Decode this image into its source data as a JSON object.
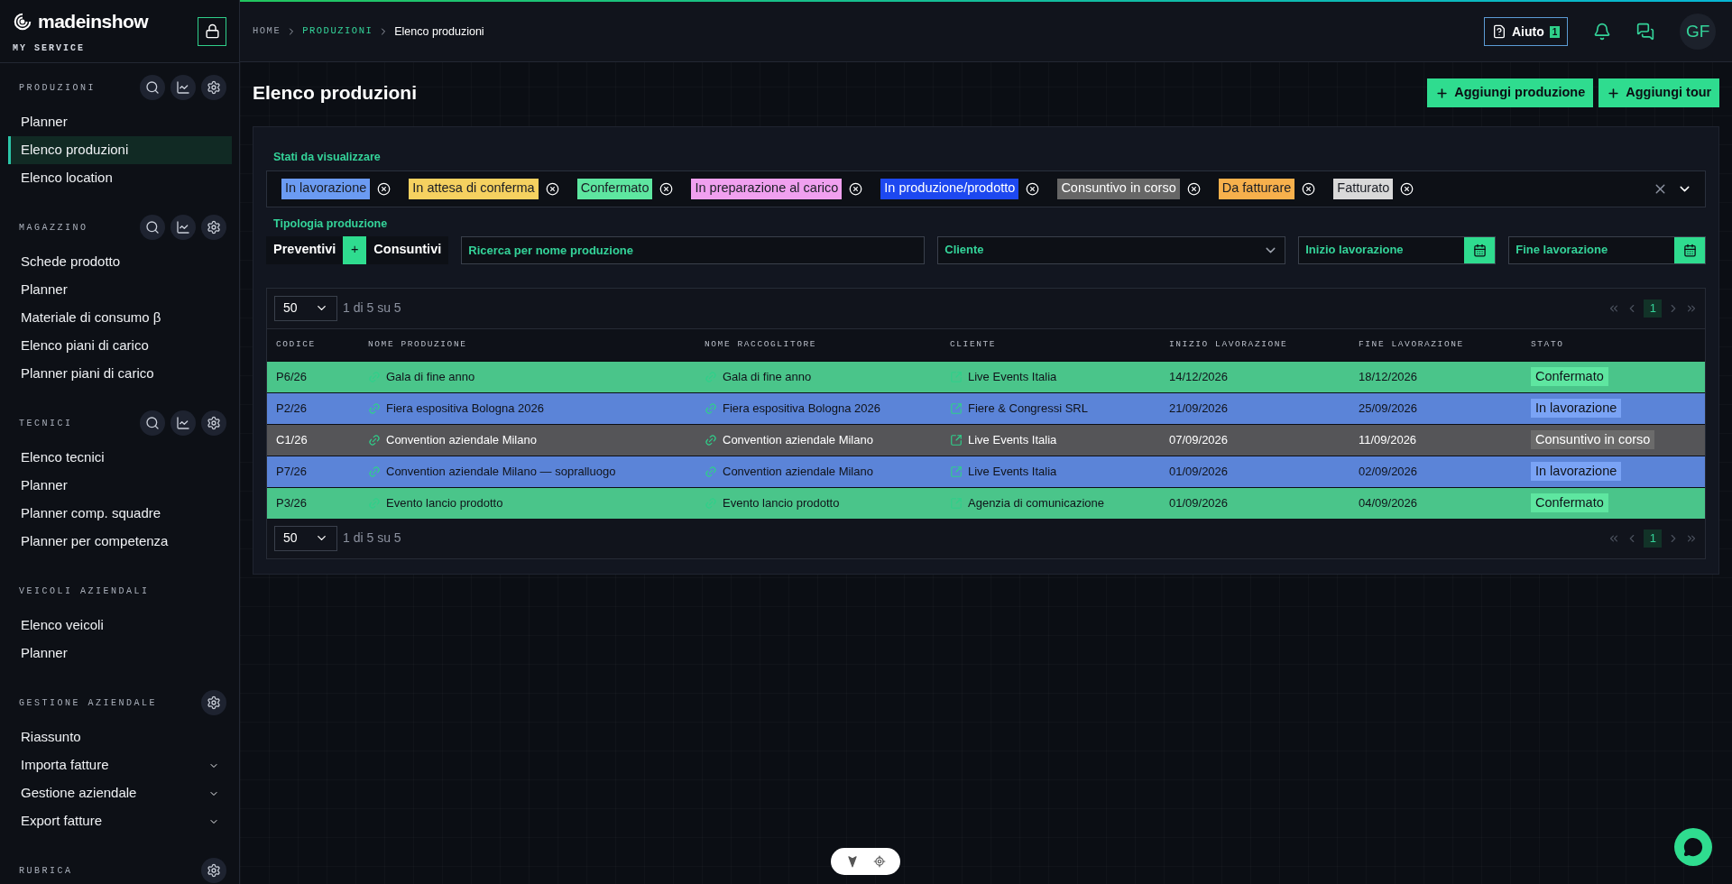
{
  "sidebar": {
    "logo": "madeinshow",
    "subtitle": "MY SERVICE",
    "sections": [
      {
        "title": "PRODUZIONI",
        "tools": [
          {
            "kind": "search"
          },
          {
            "kind": "chart"
          },
          {
            "kind": "settings"
          }
        ],
        "items": [
          {
            "label": "Planner",
            "selected": false,
            "kind": "link"
          },
          {
            "label": "Elenco produzioni",
            "selected": true,
            "kind": "link"
          },
          {
            "label": "Elenco location",
            "selected": false,
            "kind": "link"
          }
        ]
      },
      {
        "title": "MAGAZZINO",
        "tools": [
          {
            "kind": "search"
          },
          {
            "kind": "chart"
          },
          {
            "kind": "settings"
          }
        ],
        "items": [
          {
            "label": "Schede prodotto",
            "selected": false,
            "kind": "link"
          },
          {
            "label": "Planner",
            "selected": false,
            "kind": "link"
          },
          {
            "label": "Materiale di consumo β",
            "selected": false,
            "kind": "link"
          },
          {
            "label": "Elenco piani di carico",
            "selected": false,
            "kind": "link"
          },
          {
            "label": "Planner piani di carico",
            "selected": false,
            "kind": "link"
          }
        ]
      },
      {
        "title": "TECNICI",
        "tools": [
          {
            "kind": "search"
          },
          {
            "kind": "chart"
          },
          {
            "kind": "settings"
          }
        ],
        "items": [
          {
            "label": "Elenco tecnici",
            "selected": false,
            "kind": "link"
          },
          {
            "label": "Planner",
            "selected": false,
            "kind": "link"
          },
          {
            "label": "Planner comp. squadre",
            "selected": false,
            "kind": "link"
          },
          {
            "label": "Planner per competenza",
            "selected": false,
            "kind": "link"
          }
        ]
      },
      {
        "title": "VEICOLI AZIENDALI",
        "items": [
          {
            "label": "Elenco veicoli",
            "selected": false,
            "kind": "link"
          },
          {
            "label": "Planner",
            "selected": false,
            "kind": "link"
          }
        ]
      },
      {
        "title": "GESTIONE AZIENDALE",
        "tools": [
          {
            "kind": "settings"
          }
        ],
        "items": [
          {
            "label": "Riassunto",
            "selected": false,
            "kind": "link"
          },
          {
            "label": "Importa fatture",
            "selected": false,
            "kind": "group"
          },
          {
            "label": "Gestione aziendale",
            "selected": false,
            "kind": "group"
          },
          {
            "label": "Export fatture",
            "selected": false,
            "kind": "group"
          }
        ]
      },
      {
        "title": "RUBRICA",
        "tools": [
          {
            "kind": "settings"
          }
        ]
      }
    ]
  },
  "breadcrumb": [
    {
      "label": "HOME",
      "kind": "link"
    },
    {
      "label": "PRODUZIONI",
      "kind": "section"
    },
    {
      "label": "Elenco produzioni",
      "kind": "current"
    }
  ],
  "header": {
    "help": {
      "label": "Aiuto",
      "badge": "1"
    },
    "avatar": "GF"
  },
  "page": {
    "title": "Elenco produzioni",
    "actions": [
      "Aggiungi produzione",
      "Aggiungi tour"
    ]
  },
  "filters": {
    "states_label": "Stati da visualizzare",
    "states": [
      {
        "label": "In lavorazione",
        "color": "#6b9bf2"
      },
      {
        "label": "In attesa di conferma",
        "color": "#f5d160"
      },
      {
        "label": "Confermato",
        "color": "#5ee6a0"
      },
      {
        "label": "In preparazione al carico",
        "color": "#f0a0ef"
      },
      {
        "label": "In produzione/prodotto",
        "color": "#1d48f0"
      },
      {
        "label": "Consuntivo in corso",
        "color": "#666666"
      },
      {
        "label": "Da fatturare",
        "color": "#f7b04c"
      },
      {
        "label": "Fatturato",
        "color": "#d9d9d9"
      }
    ],
    "type_label": "Tipologia produzione",
    "type_toggle": [
      {
        "label": "Preventivi",
        "selected": false
      },
      {
        "label": "+",
        "selected": true
      },
      {
        "label": "Consuntivi",
        "selected": false
      }
    ],
    "search": {
      "placeholder": "Ricerca per nome produzione"
    },
    "client": {
      "placeholder": "Cliente"
    },
    "start": {
      "placeholder": "Inizio lavorazione"
    },
    "end": {
      "placeholder": "Fine lavorazione"
    }
  },
  "table": {
    "pager_top": {
      "page_size": "50",
      "range": "1 di 5 su 5",
      "current_page": "1"
    },
    "columns": [
      {
        "label": "CODICE",
        "kind": "text"
      },
      {
        "label": "NOME PRODUZIONE",
        "kind": "link"
      },
      {
        "label": "NOME RACCOGLITORE",
        "kind": "link"
      },
      {
        "label": "CLIENTE",
        "kind": "external"
      },
      {
        "label": "INIZIO LAVORAZIONE",
        "kind": "text"
      },
      {
        "label": "FINE LAVORAZIONE",
        "kind": "text"
      },
      {
        "label": "STATO",
        "kind": "status"
      }
    ],
    "rows": [
      {
        "color": "#4ac58a",
        "cells": [
          "P6/26",
          "Gala di fine anno",
          "Gala di fine anno",
          "Live Events Italia",
          "14/12/2026",
          "18/12/2026"
        ],
        "status": {
          "label": "Confermato",
          "color": "#5ee6a0"
        }
      },
      {
        "color": "#5b84d8",
        "cells": [
          "P2/26",
          "Fiera espositiva Bologna 2026",
          "Fiera espositiva Bologna 2026",
          "Fiere & Congressi SRL",
          "21/09/2026",
          "25/09/2026"
        ],
        "status": {
          "label": "In lavorazione",
          "color": "#7aa3f5"
        }
      },
      {
        "color": "#555558",
        "cells": [
          "C1/26",
          "Convention aziendale Milano",
          "Convention aziendale Milano",
          "Live Events Italia",
          "07/09/2026",
          "11/09/2026"
        ],
        "status": {
          "label": "Consuntivo in corso",
          "color": "#6b6b6b"
        }
      },
      {
        "color": "#5b84d8",
        "cells": [
          "P7/26",
          "Convention aziendale Milano — sopralluogo",
          "Convention aziendale Milano",
          "Live Events Italia",
          "01/09/2026",
          "02/09/2026"
        ],
        "status": {
          "label": "In lavorazione",
          "color": "#7aa3f5"
        }
      },
      {
        "color": "#4ac58a",
        "cells": [
          "P3/26",
          "Evento lancio prodotto",
          "Evento lancio prodotto",
          "Agenzia di comunicazione",
          "01/09/2026",
          "04/09/2026"
        ],
        "status": {
          "label": "Confermato",
          "color": "#5ee6a0"
        }
      }
    ],
    "pager_bottom": {
      "page_size": "50",
      "range": "1 di 5 su 5",
      "current_page": "1"
    }
  }
}
